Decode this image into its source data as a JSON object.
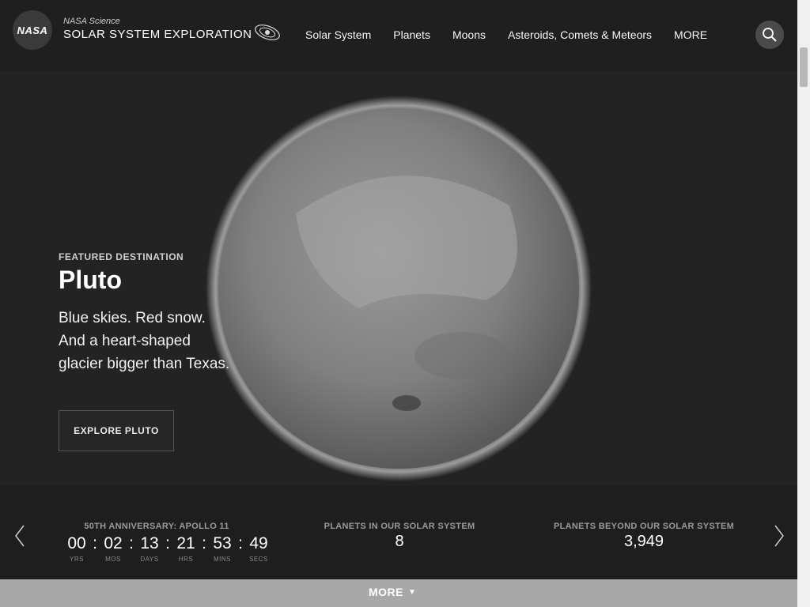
{
  "header": {
    "logo_text": "NASA",
    "brand_sub": "NASA Science",
    "brand_main": "SOLAR SYSTEM EXPLORATION",
    "nav": [
      "Solar System",
      "Planets",
      "Moons",
      "Asteroids, Comets & Meteors",
      "MORE"
    ],
    "search_icon": "search-icon"
  },
  "hero": {
    "label": "FEATURED DESTINATION",
    "title": "Pluto",
    "description": "Blue skies. Red snow. And a heart-shaped glacier bigger than Texas.",
    "cta": "EXPLORE PLUTO"
  },
  "stats": {
    "countdown_label": "50TH ANNIVERSARY: APOLLO 11",
    "countdown": {
      "years": "00",
      "months": "02",
      "days": "13",
      "hours": "21",
      "mins": "53",
      "secs": "49",
      "years_lbl": "YRS",
      "months_lbl": "MOS",
      "days_lbl": "DAYS",
      "hours_lbl": "HRS",
      "mins_lbl": "MINS",
      "secs_lbl": "SECS"
    },
    "planets_label": "PLANETS IN OUR SOLAR SYSTEM",
    "planets_value": "8",
    "exo_label": "PLANETS BEYOND OUR SOLAR SYSTEM",
    "exo_value": "3,949",
    "prev_icon": "chevron-left-icon",
    "next_icon": "chevron-right-icon"
  },
  "footer": {
    "more_label": "MORE"
  },
  "colors": {
    "background": "#1f1f1f",
    "text": "#ffffff",
    "muted": "#9a9a9a",
    "bottom_bar": "#a8a8a8"
  }
}
